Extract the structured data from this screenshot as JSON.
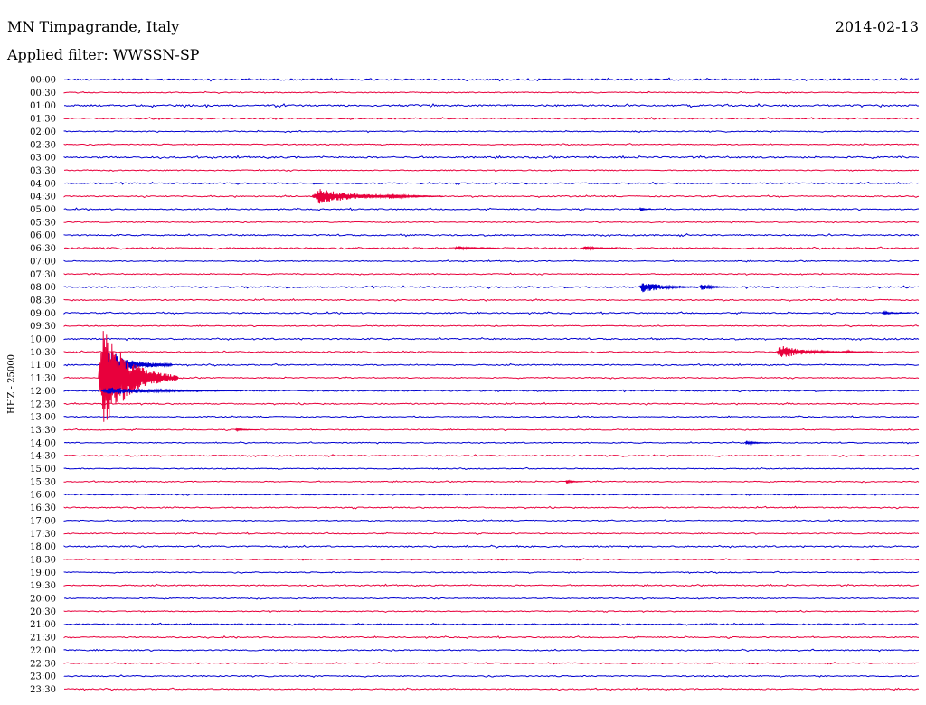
{
  "header": {
    "station": "MN Timpagrande, Italy",
    "date": "2014-02-13",
    "filter": "Applied filter: WWSSN-SP"
  },
  "chart_data": {
    "type": "line",
    "title": "MN Timpagrande, Italy",
    "subtitle": "Applied filter: WWSSN-SP",
    "ylabel": "HHZ - 25000",
    "row_labels": [
      "00:00",
      "00:30",
      "01:00",
      "01:30",
      "02:00",
      "02:30",
      "03:00",
      "03:30",
      "04:00",
      "04:30",
      "05:00",
      "05:30",
      "06:00",
      "06:30",
      "07:00",
      "07:30",
      "08:00",
      "08:30",
      "09:00",
      "09:30",
      "10:00",
      "10:30",
      "11:00",
      "11:30",
      "12:00",
      "12:30",
      "13:00",
      "13:30",
      "14:00",
      "14:30",
      "15:00",
      "15:30",
      "16:00",
      "16:30",
      "17:00",
      "17:30",
      "18:00",
      "18:30",
      "19:00",
      "19:30",
      "20:00",
      "20:30",
      "21:00",
      "21:30",
      "22:00",
      "22:30",
      "23:00",
      "23:30"
    ],
    "row_minutes": 30,
    "colors": [
      "#0000d0",
      "#e8003c"
    ],
    "noise": [
      0.8,
      0.5,
      0.9,
      0.6,
      0.5,
      0.5,
      0.8,
      0.5,
      0.6,
      0.6,
      0.6,
      0.5,
      0.7,
      0.7,
      0.5,
      0.5,
      0.7,
      0.6,
      0.6,
      0.5,
      0.7,
      0.6,
      0.6,
      0.5,
      0.6,
      0.6,
      0.5,
      0.5,
      0.5,
      0.6,
      0.5,
      0.5,
      0.5,
      0.6,
      0.5,
      0.5,
      0.7,
      0.5,
      0.5,
      0.6,
      0.5,
      0.5,
      0.6,
      0.6,
      0.6,
      0.5,
      0.6,
      0.6
    ],
    "events": [
      {
        "row": 9,
        "start_min": 8.7,
        "duration_min": 4.2,
        "amplitude": 10
      },
      {
        "row": 9,
        "start_min": 11.3,
        "duration_min": 2.0,
        "amplitude": 4
      },
      {
        "row": 10,
        "start_min": 20.2,
        "duration_min": 0.4,
        "amplitude": 3
      },
      {
        "row": 13,
        "start_min": 13.7,
        "duration_min": 1.4,
        "amplitude": 3
      },
      {
        "row": 13,
        "start_min": 18.2,
        "duration_min": 1.2,
        "amplitude": 3
      },
      {
        "row": 16,
        "start_min": 20.2,
        "duration_min": 2.0,
        "amplitude": 8
      },
      {
        "row": 16,
        "start_min": 22.3,
        "duration_min": 1.2,
        "amplitude": 4
      },
      {
        "row": 18,
        "start_min": 28.7,
        "duration_min": 1.0,
        "amplitude": 2
      },
      {
        "row": 21,
        "start_min": 25.0,
        "duration_min": 2.5,
        "amplitude": 9
      },
      {
        "row": 21,
        "start_min": 27.4,
        "duration_min": 1.0,
        "amplitude": 2
      },
      {
        "row": 22,
        "start_min": 1.3,
        "duration_min": 2.5,
        "amplitude": 24
      },
      {
        "row": 23,
        "start_min": 1.2,
        "duration_min": 2.8,
        "amplitude": 70
      },
      {
        "row": 24,
        "start_min": 1.3,
        "duration_min": 5.0,
        "amplitude": 5
      },
      {
        "row": 27,
        "start_min": 6.0,
        "duration_min": 0.8,
        "amplitude": 2
      },
      {
        "row": 28,
        "start_min": 23.9,
        "duration_min": 0.8,
        "amplitude": 3
      },
      {
        "row": 31,
        "start_min": 17.6,
        "duration_min": 0.6,
        "amplitude": 3
      }
    ]
  }
}
